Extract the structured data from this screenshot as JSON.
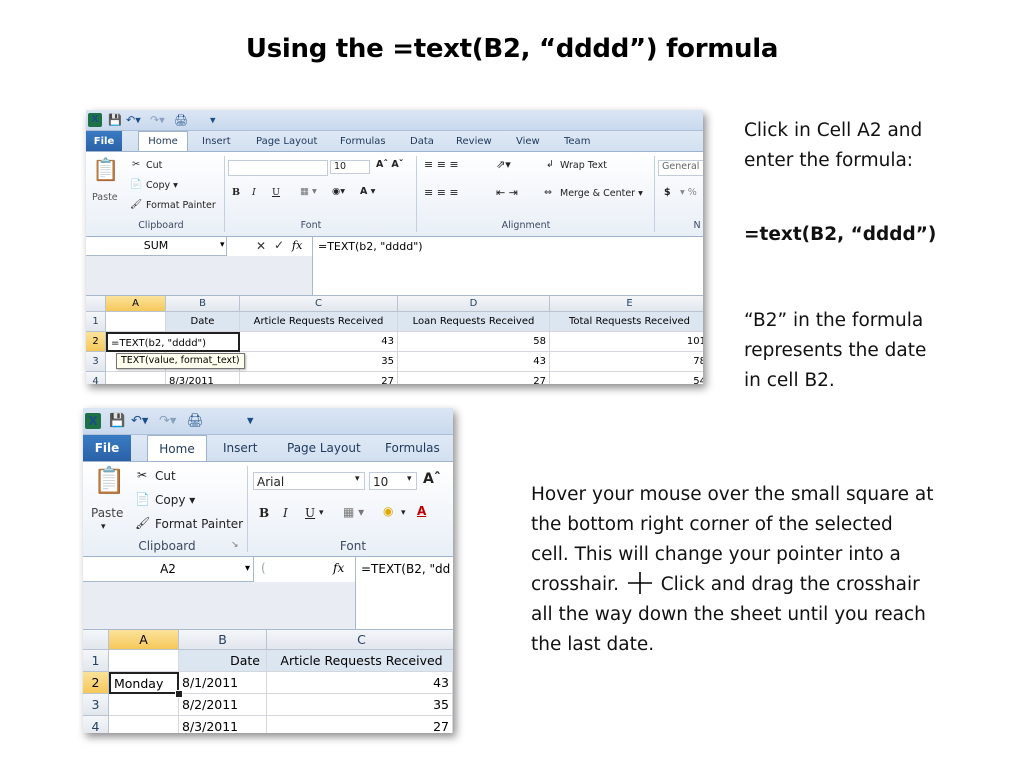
{
  "title": "Using the =text(B2, “dddd”) formula",
  "notes": {
    "n1a": "Click in Cell A2 and",
    "n1b": "enter the formula:",
    "formula": "=text(B2, “dddd”)",
    "n2a": "“B2” in the formula",
    "n2b": "represents the date",
    "n2c": "in cell B2.",
    "n3a": "Hover your mouse over the small square at",
    "n3b": "the bottom right corner of the selected",
    "n3c": "cell.  This will change your pointer into a",
    "n3d_pre": "crosshair.",
    "n3d_post": "Click and drag the crosshair",
    "n3e": "all the way down the sheet until you reach",
    "n3f": "the last date."
  },
  "shot1": {
    "tabs": [
      "File",
      "Home",
      "Insert",
      "Page Layout",
      "Formulas",
      "Data",
      "Review",
      "View",
      "Team"
    ],
    "clipboard": {
      "cut": "Cut",
      "copy": "Copy ▾",
      "format_painter": "Format Painter",
      "paste": "Paste",
      "group": "Clipboard"
    },
    "font": {
      "size": "10",
      "group": "Font"
    },
    "alignment": {
      "wrap": "Wrap Text",
      "merge": "Merge & Center ▾",
      "group": "Alignment"
    },
    "number": {
      "format": "General",
      "currency": "$",
      "group": "N"
    },
    "name_box": "SUM",
    "formula": "=TEXT(b2, \"dddd\")",
    "columns": [
      "A",
      "B",
      "C",
      "D",
      "E"
    ],
    "rows": [
      "1",
      "2",
      "3",
      "4"
    ],
    "header_row": [
      "",
      "Date",
      "Article Requests Received",
      "Loan Requests Received",
      "Total Requests Received"
    ],
    "row2": [
      "=TEXT(b2, \"dddd\")",
      "",
      "43",
      "58",
      "101"
    ],
    "row3": [
      "",
      "",
      "35",
      "43",
      "78"
    ],
    "row4": [
      "",
      "8/3/2011",
      "27",
      "27",
      "54"
    ],
    "tooltip": "TEXT(value, format_text)"
  },
  "shot2": {
    "tabs": [
      "File",
      "Home",
      "Insert",
      "Page Layout",
      "Formulas"
    ],
    "clipboard": {
      "cut": "Cut",
      "copy": "Copy ▾",
      "format_painter": "Format Painter",
      "paste": "Paste",
      "group": "Clipboard"
    },
    "font": {
      "name": "Arial",
      "size": "10",
      "group": "Font"
    },
    "name_box": "A2",
    "formula": "=TEXT(B2, \"dd",
    "columns": [
      "A",
      "B",
      "C"
    ],
    "rows": [
      "1",
      "2",
      "3",
      "4"
    ],
    "header_row": [
      "",
      "Date",
      "Article Requests Received"
    ],
    "row2": [
      "Monday",
      "8/1/2011",
      "43"
    ],
    "row3": [
      "",
      "8/2/2011",
      "35"
    ],
    "row4": [
      "",
      "8/3/2011",
      "27"
    ]
  },
  "colors": {
    "excel_green": "#1e7145",
    "file_tab": "#2a62a8",
    "selected_header": "#f6c85a",
    "table_header": "#dce6f1"
  }
}
